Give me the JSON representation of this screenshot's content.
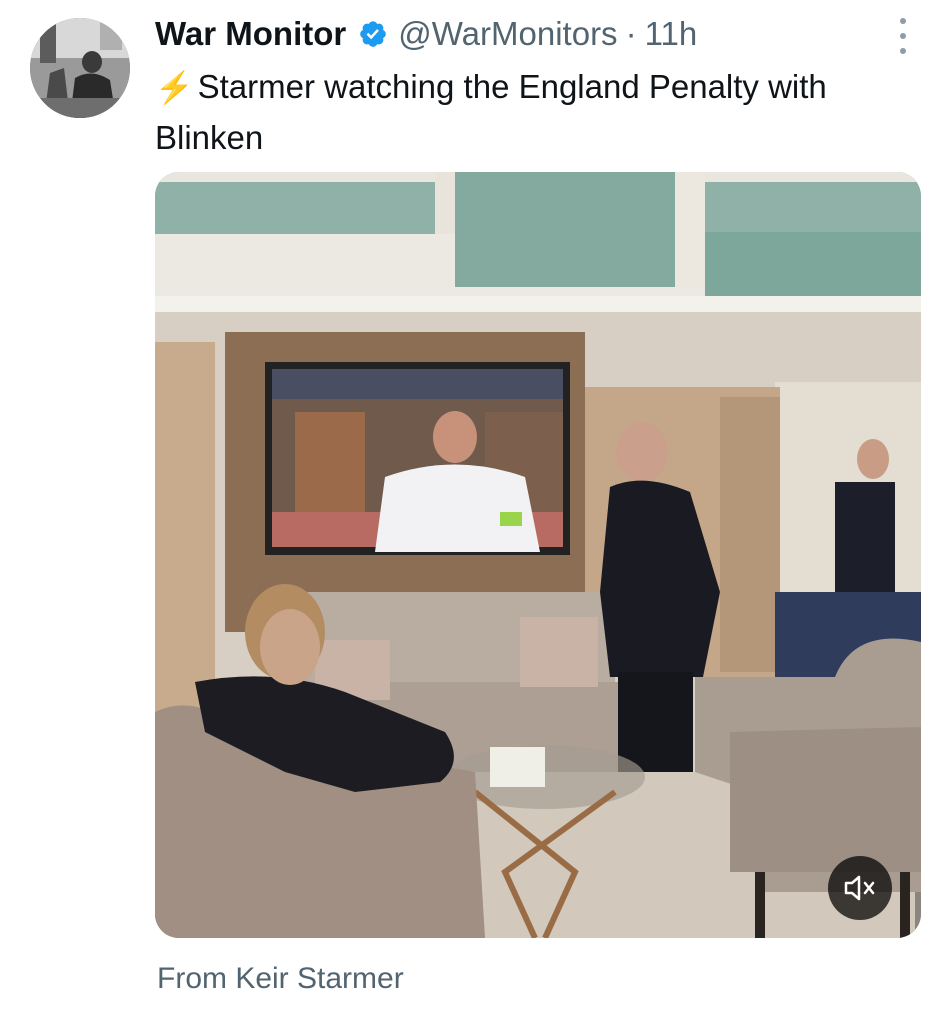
{
  "author": {
    "name": "War Monitor",
    "handle": "@WarMonitors",
    "separator": "·",
    "time": "11h",
    "verified_color": "#1d9bf0"
  },
  "tweet": {
    "emoji": "⚡",
    "text": "Starmer watching the England Penalty with Blinken"
  },
  "media": {
    "type": "video",
    "audio": "muted",
    "mute_icon": "speaker-muted-icon"
  },
  "source_label": "From Keir Starmer",
  "icons": {
    "more": "more-vertical-icon",
    "verified": "verified-badge-icon"
  }
}
